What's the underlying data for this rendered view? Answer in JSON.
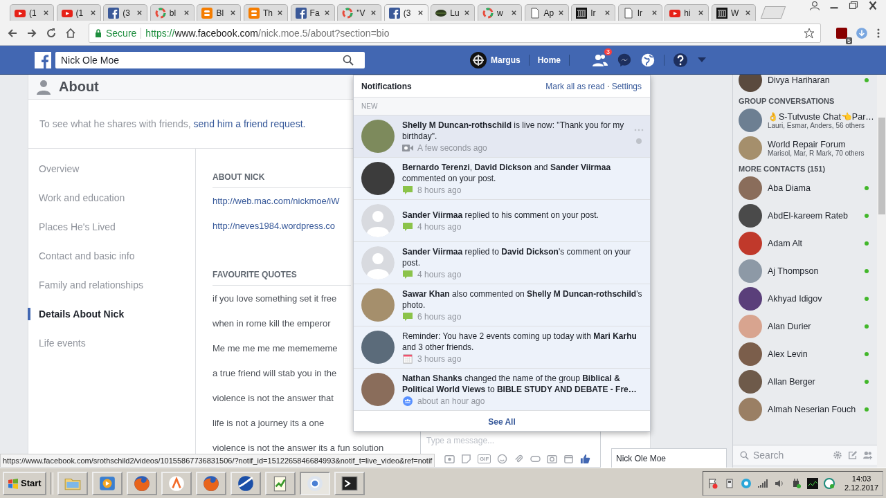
{
  "browser": {
    "tabs": [
      {
        "kind": "youtube",
        "title": "(1",
        "selected": false
      },
      {
        "kind": "youtube",
        "title": "(1",
        "selected": false
      },
      {
        "kind": "facebook",
        "title": "(3",
        "selected": false
      },
      {
        "kind": "ring",
        "title": "bl",
        "selected": false
      },
      {
        "kind": "blogger",
        "title": "Bl",
        "selected": false
      },
      {
        "kind": "blogger",
        "title": "Th",
        "selected": false
      },
      {
        "kind": "facebook",
        "title": "Fa",
        "selected": false
      },
      {
        "kind": "ring",
        "title": "\"V",
        "selected": false
      },
      {
        "kind": "facebook",
        "title": "(3",
        "selected": true
      },
      {
        "kind": "leaf",
        "title": "Lu",
        "selected": false
      },
      {
        "kind": "ring",
        "title": "w",
        "selected": false
      },
      {
        "kind": "page",
        "title": "Ap",
        "selected": false
      },
      {
        "kind": "museum",
        "title": "Ir",
        "selected": false
      },
      {
        "kind": "page",
        "title": "Ir",
        "selected": false
      },
      {
        "kind": "youtube",
        "title": "hi",
        "selected": false
      },
      {
        "kind": "museum",
        "title": "W",
        "selected": false
      }
    ],
    "address": {
      "secure_label": "Secure",
      "scheme": "https://",
      "host": "www.facebook.com",
      "path": "/nick.moe.5/about?section=bio"
    },
    "extension_badge": "5",
    "status_url": "https://www.facebook.com/srothschild2/videos/10155867736831506/?notif_id=1512265846684993&notif_t=live_video&ref=notif"
  },
  "topbar": {
    "search_value": "Nick Ole Moe",
    "profile_name": "Margus",
    "home": "Home",
    "friend_requests_badge": "3"
  },
  "about": {
    "title": "About",
    "friend_prompt": "To see what he shares with friends,",
    "friend_link": "send him a friend request.",
    "nav": [
      {
        "label": "Overview",
        "selected": false
      },
      {
        "label": "Work and education",
        "selected": false
      },
      {
        "label": "Places He's Lived",
        "selected": false
      },
      {
        "label": "Contact and basic info",
        "selected": false
      },
      {
        "label": "Family and relationships",
        "selected": false
      },
      {
        "label": "Details About Nick",
        "selected": true
      },
      {
        "label": "Life events",
        "selected": false
      }
    ],
    "about_heading": "ABOUT NICK",
    "links": [
      "http://web.mac.com/nickmoe/iW",
      "http://neves1984.wordpress.co"
    ],
    "quotes_heading": "FAVOURITE QUOTES",
    "quotes": [
      "if you love something set it free",
      "when in rome kill the emperor",
      "Me me me me me memememe",
      "a true friend will stab you in the",
      "violence is not the answer that",
      "life is not a journey its a one",
      "violence is not the answer its a fun solution"
    ]
  },
  "notifications": {
    "title": "Notifications",
    "actions": [
      "Mark all as read",
      "Settings"
    ],
    "section": "NEW",
    "items": [
      {
        "avatar": {
          "kind": "photo"
        },
        "text": "**Shelly M Duncan-rothschild** is live now: \"Thank you for my birthday\".",
        "kind": "video",
        "time": "A few seconds ago",
        "highlighted": true
      },
      {
        "avatar": {
          "kind": "photo"
        },
        "text": "**Bernardo Terenzi**, **David Dickson** and **Sander Viirmaa** commented on your post.",
        "kind": "comment",
        "time": "8 hours ago",
        "highlighted": false
      },
      {
        "avatar": {
          "kind": "silhouette"
        },
        "text": "**Sander Viirmaa** replied to his comment on your post.",
        "kind": "comment",
        "time": "4 hours ago",
        "highlighted": false
      },
      {
        "avatar": {
          "kind": "silhouette"
        },
        "text": "**Sander Viirmaa** replied to **David Dickson**'s comment on your post.",
        "kind": "comment",
        "time": "4 hours ago",
        "highlighted": false
      },
      {
        "avatar": {
          "kind": "photo"
        },
        "text": "**Sawar Khan** also commented on **Shelly M Duncan-rothschild**'s photo.",
        "kind": "comment",
        "time": "6 hours ago",
        "highlighted": false
      },
      {
        "avatar": {
          "kind": "photo"
        },
        "text": "Reminder: You have 2 events coming up today with **Mari Karhu** and 3 other friends.",
        "kind": "calendar",
        "time": "3 hours ago",
        "highlighted": false
      },
      {
        "avatar": {
          "kind": "photo"
        },
        "text": "**Nathan Shanks** changed the name of the group **Biblical & Political World Views** to **BIBLE STUDY AND DEBATE - Fre…**",
        "kind": "group",
        "time": "about an hour ago",
        "highlighted": false
      }
    ],
    "footer": "See All"
  },
  "chat_sidebar": {
    "top_contact": {
      "name": "Divya Hariharan",
      "online": true
    },
    "groups_heading": "GROUP CONVERSATIONS",
    "groups": [
      {
        "name": "👌S-Tutvuste Chat👈Par…",
        "members": "Lauri, Esmar, Anders, 56 others"
      },
      {
        "name": "World Repair Forum",
        "members": "Marisol, Mar, R Mark, 70 others"
      }
    ],
    "contacts_heading": "MORE CONTACTS (151)",
    "contacts": [
      {
        "name": "Aba Diama",
        "online": true
      },
      {
        "name": "AbdEl-kareem Rateb",
        "online": true
      },
      {
        "name": "Adam Alt",
        "online": true
      },
      {
        "name": "Aj Thompson",
        "online": true
      },
      {
        "name": "Akhyad Idigov",
        "online": true
      },
      {
        "name": "Alan Durier",
        "online": true
      },
      {
        "name": "Alex Levin",
        "online": true
      },
      {
        "name": "Allan Berger",
        "online": true
      },
      {
        "name": "Almah Neserian Fouch",
        "online": true
      }
    ],
    "search_placeholder": "Search"
  },
  "chat_window": {
    "placeholder": "Type a message...",
    "gif_label": "GIF",
    "tab_name": "Nick Ole Moe"
  },
  "taskbar": {
    "start": "Start",
    "apps": [
      {
        "kind": "folder",
        "active": false
      },
      {
        "kind": "media",
        "active": false
      },
      {
        "kind": "firefox",
        "active": false
      },
      {
        "kind": "avast",
        "active": false
      },
      {
        "kind": "firefox",
        "active": false
      },
      {
        "kind": "swirl",
        "active": false
      },
      {
        "kind": "notepad",
        "active": false
      },
      {
        "kind": "chrome",
        "active": true
      },
      {
        "kind": "terminal",
        "active": false
      }
    ],
    "tray": [
      {
        "kind": "flag"
      },
      {
        "kind": "usb"
      },
      {
        "kind": "eye"
      },
      {
        "kind": "signal"
      },
      {
        "kind": "speaker"
      },
      {
        "kind": "power"
      },
      {
        "kind": "chart"
      },
      {
        "kind": "app"
      }
    ],
    "time": "14:03",
    "date": "2.12.2017"
  }
}
